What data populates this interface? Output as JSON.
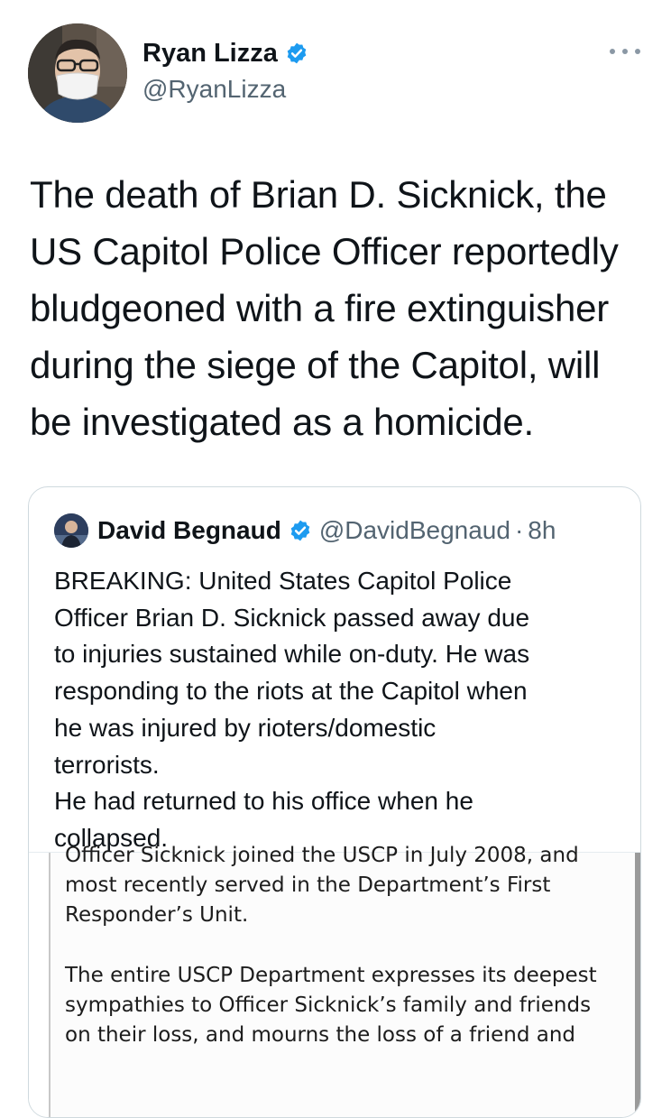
{
  "author": {
    "display_name": "Ryan Lizza",
    "handle": "@RyanLizza",
    "verified": true,
    "avatar_icon": "profile-photo-masked-man"
  },
  "more_icon": "ellipsis-icon",
  "tweet": {
    "lines": [
      "The death of Brian D. Sicknick, the",
      "US Capitol Police Officer reportedly",
      "bludgeoned with a fire extinguisher",
      "during the siege of the Capitol, will",
      "be investigated as a homicide."
    ]
  },
  "quoted": {
    "display_name": "David Begnaud",
    "handle": "@DavidBegnaud",
    "separator": "·",
    "time": "8h",
    "verified": true,
    "lines": [
      "BREAKING: United States Capitol Police",
      "Officer Brian D. Sicknick passed away due",
      "to injuries sustained while on-duty. He was",
      "responding to the riots at the Capitol when",
      "he was injured by rioters/domestic",
      "terrorists.",
      "He had returned to his office when he",
      "collapsed."
    ],
    "media": {
      "top_lines": [
        "Officer Sicknick joined the USCP in July 2008, and",
        "most recently served in the Department’s First",
        "Responder’s Unit."
      ],
      "bottom_lines": [
        "The entire USCP Department expresses its deepest",
        "sympathies to Officer Sicknick’s family and friends",
        "on their loss, and mourns the loss of a friend and"
      ]
    }
  },
  "colors": {
    "verified_blue": "#1d9bf0",
    "secondary_text": "#536471",
    "border": "#cfd9de"
  }
}
